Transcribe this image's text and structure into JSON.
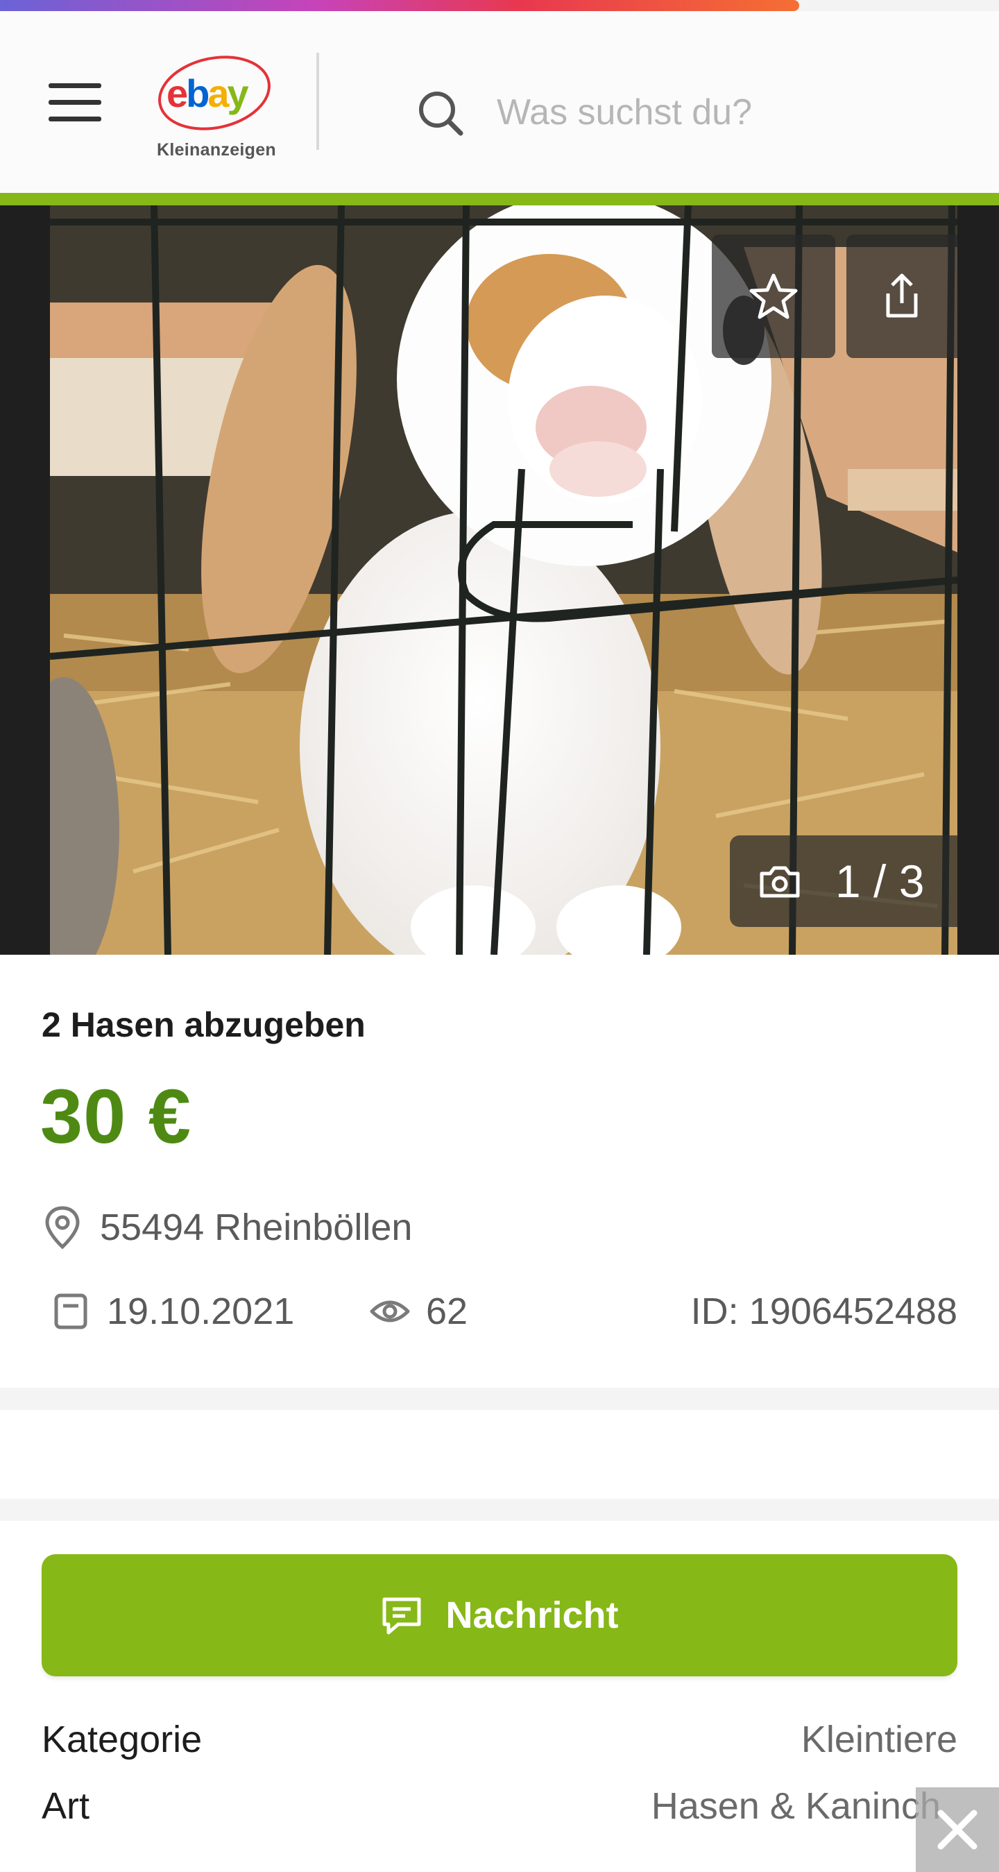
{
  "header": {
    "logo_text": "ebay",
    "logo_subtitle": "Kleinanzeigen",
    "search_placeholder": "Was suchst du?",
    "load_progress": 0.8
  },
  "gallery": {
    "image_subject": "rabbit-in-cage-photo",
    "counter_current": "1",
    "counter_separator": "/",
    "counter_total": "3",
    "counter_text": "1 / 3"
  },
  "ad": {
    "title": "2 Hasen abzugeben",
    "price": "30 €",
    "location": "55494 Rheinböllen",
    "date": "19.10.2021",
    "views": "62",
    "id_text": "ID: 1906452488"
  },
  "actions": {
    "message_label": "Nachricht"
  },
  "details": [
    {
      "key": "Kategorie",
      "value": "Kleintiere"
    },
    {
      "key": "Art",
      "value": "Hasen & Kaninch"
    }
  ],
  "colors": {
    "brand_green": "#86b817",
    "price_green": "#4e8a13"
  },
  "icons": [
    "menu-icon",
    "search-icon",
    "star-icon",
    "share-icon",
    "camera-icon",
    "location-pin-icon",
    "calendar-icon",
    "eye-icon",
    "message-icon",
    "close-icon"
  ]
}
